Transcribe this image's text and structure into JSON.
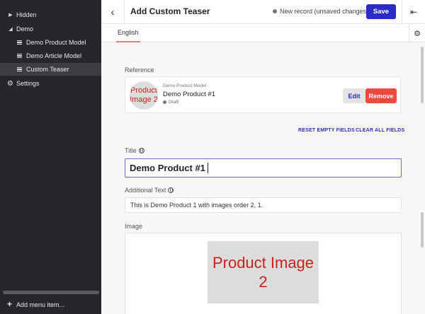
{
  "sidebar": {
    "items": [
      {
        "label": "Hidden",
        "icon": "caret-right-icon"
      },
      {
        "label": "Demo",
        "icon": "caret-down-icon"
      },
      {
        "label": "Demo Product Model",
        "icon": "list-icon"
      },
      {
        "label": "Demo Article Model",
        "icon": "list-icon"
      },
      {
        "label": "Custom Teaser",
        "icon": "list-icon",
        "active": true
      },
      {
        "label": "Settings",
        "icon": "gear-icon"
      }
    ],
    "add_menu_label": "Add menu item..."
  },
  "header": {
    "title": "Add Custom Teaser",
    "status": "New record (unsaved changes)",
    "save_label": "Save"
  },
  "tabs": [
    {
      "label": "English"
    }
  ],
  "form": {
    "reference": {
      "label": "Reference",
      "model": "Demo Product Model",
      "name": "Demo Product #1",
      "status": "Draft",
      "thumbnail_text": "Product Image 2",
      "edit_label": "Edit",
      "remove_label": "Remove"
    },
    "reset_empty_label": "RESET EMPTY FIELDS",
    "clear_all_label": "CLEAR ALL FIELDS",
    "title": {
      "label": "Title",
      "value": "Demo Product #1"
    },
    "additional_text": {
      "label": "Additional Text",
      "value": "This is Demo Product 1 with images order 2, 1."
    },
    "image": {
      "label": "Image",
      "text": "Product Image 2"
    }
  },
  "colors": {
    "sidebar_bg": "#26272b",
    "accent": "#2b2bc9",
    "danger": "#f0483e",
    "image_text": "#c8211e"
  }
}
